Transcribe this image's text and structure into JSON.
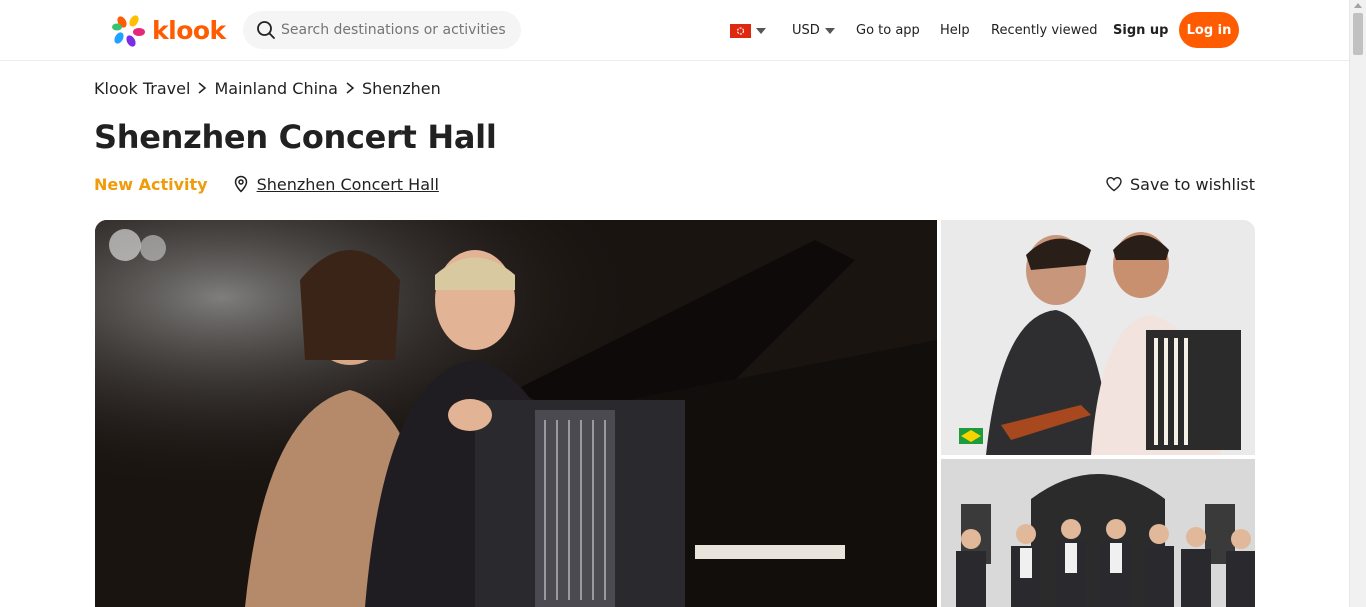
{
  "header": {
    "logo_text": "klook",
    "search_placeholder": "Search destinations or activities",
    "currency": "USD",
    "go_to_app": "Go to app",
    "help": "Help",
    "recently_viewed": "Recently viewed",
    "sign_up": "Sign up",
    "log_in": "Log in",
    "brand_color": "#ff5b00"
  },
  "breadcrumb": [
    "Klook Travel",
    "Mainland China",
    "Shenzhen"
  ],
  "title": "Shenzhen Concert Hall",
  "badge": "New Activity",
  "badge_color": "#f09b0a",
  "location": "Shenzhen Concert Hall",
  "wishlist": "Save to wishlist",
  "icons": [
    "search-icon",
    "hk-flag-icon",
    "chevron-down-icon",
    "chevron-right-icon",
    "map-pin-icon",
    "heart-icon"
  ]
}
